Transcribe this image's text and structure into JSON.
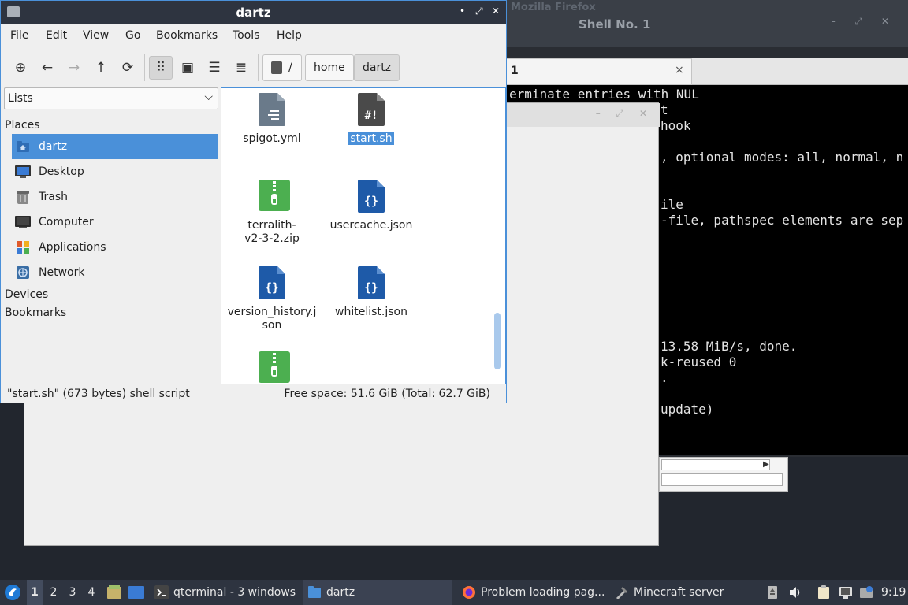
{
  "background_terminal": {
    "firefox_title": "Mozilla Firefox",
    "shell_title": "Shell No. 1",
    "tab_label": "1",
    "tab_close": "×",
    "lines": [
      "erminate entries with NUL",
      "t",
      "hook",
      ", optional modes: all, normal, n",
      "ile",
      "-file, pathspec elements are sep",
      "13.58 MiB/s, done.",
      "k-reused 0",
      ".",
      "update)"
    ]
  },
  "file_manager": {
    "title": "dartz",
    "window_buttons": {
      "minimize": "•",
      "maximize": "⤢",
      "close": "✕"
    },
    "menu": [
      "File",
      "Edit",
      "View",
      "Go",
      "Bookmarks",
      "Tools",
      "Help"
    ],
    "toolbar_icons": {
      "new_tab": "⊕",
      "back": "←",
      "forward": "→",
      "up": "↑",
      "reload": "⟳",
      "icon_view": "⠿",
      "thumbnail_view": "▣",
      "compact_view": "☰",
      "detail_view": "≣"
    },
    "breadcrumb": [
      "/",
      "home",
      "dartz"
    ],
    "sidebar": {
      "selector_value": "Lists",
      "chevron": "⌵",
      "places_header": "Places",
      "items": [
        {
          "label": "dartz",
          "icon": "home-folder-icon",
          "color": "#4a90d9"
        },
        {
          "label": "Desktop",
          "icon": "desktop-icon",
          "color": "#3a7bd5"
        },
        {
          "label": "Trash",
          "icon": "trash-icon",
          "color": "#777777"
        },
        {
          "label": "Computer",
          "icon": "computer-icon",
          "color": "#333333"
        },
        {
          "label": "Applications",
          "icon": "applications-icon",
          "color": "#e05a2a"
        },
        {
          "label": "Network",
          "icon": "network-icon",
          "color": "#3a6ea5"
        }
      ],
      "devices_header": "Devices",
      "bookmarks_header": "Bookmarks"
    },
    "files": [
      {
        "name": "spigot.yml",
        "type": "text",
        "glyph": "≡"
      },
      {
        "name": "start.sh",
        "type": "script",
        "glyph": "#!",
        "selected": true
      },
      {
        "name": "terralith-\nv2-3-2.zip",
        "type": "zip",
        "glyph": ""
      },
      {
        "name": "usercache.json",
        "type": "json",
        "glyph": "{}"
      },
      {
        "name": "version_history.j\nson",
        "type": "json",
        "glyph": "{}"
      },
      {
        "name": "whitelist.json",
        "type": "json",
        "glyph": "{}"
      },
      {
        "name": "",
        "type": "zip",
        "glyph": ""
      }
    ],
    "status_left": "\"start.sh\" (673 bytes) shell script",
    "status_right": "Free space: 51.6 GiB (Total: 62.7 GiB)"
  },
  "taskbar": {
    "desktops": [
      "1",
      "2",
      "3",
      "4"
    ],
    "current_desktop": "1",
    "tasks": [
      {
        "label": "qterminal - 3 windows",
        "icon": "terminal-icon"
      },
      {
        "label": "dartz",
        "icon": "folder-icon"
      },
      {
        "label": "Problem loading pag...",
        "icon": "firefox-icon"
      },
      {
        "label": "Minecraft server",
        "icon": "minecraft-icon"
      }
    ],
    "clock": "9:19"
  },
  "colors": {
    "accent": "#4a90d9",
    "titlebar": "#2e3440",
    "zip_green": "#4caf50",
    "json_blue": "#1e5aa8",
    "script_dark": "#4a4a4a",
    "text_gray": "#6a7a8a"
  }
}
